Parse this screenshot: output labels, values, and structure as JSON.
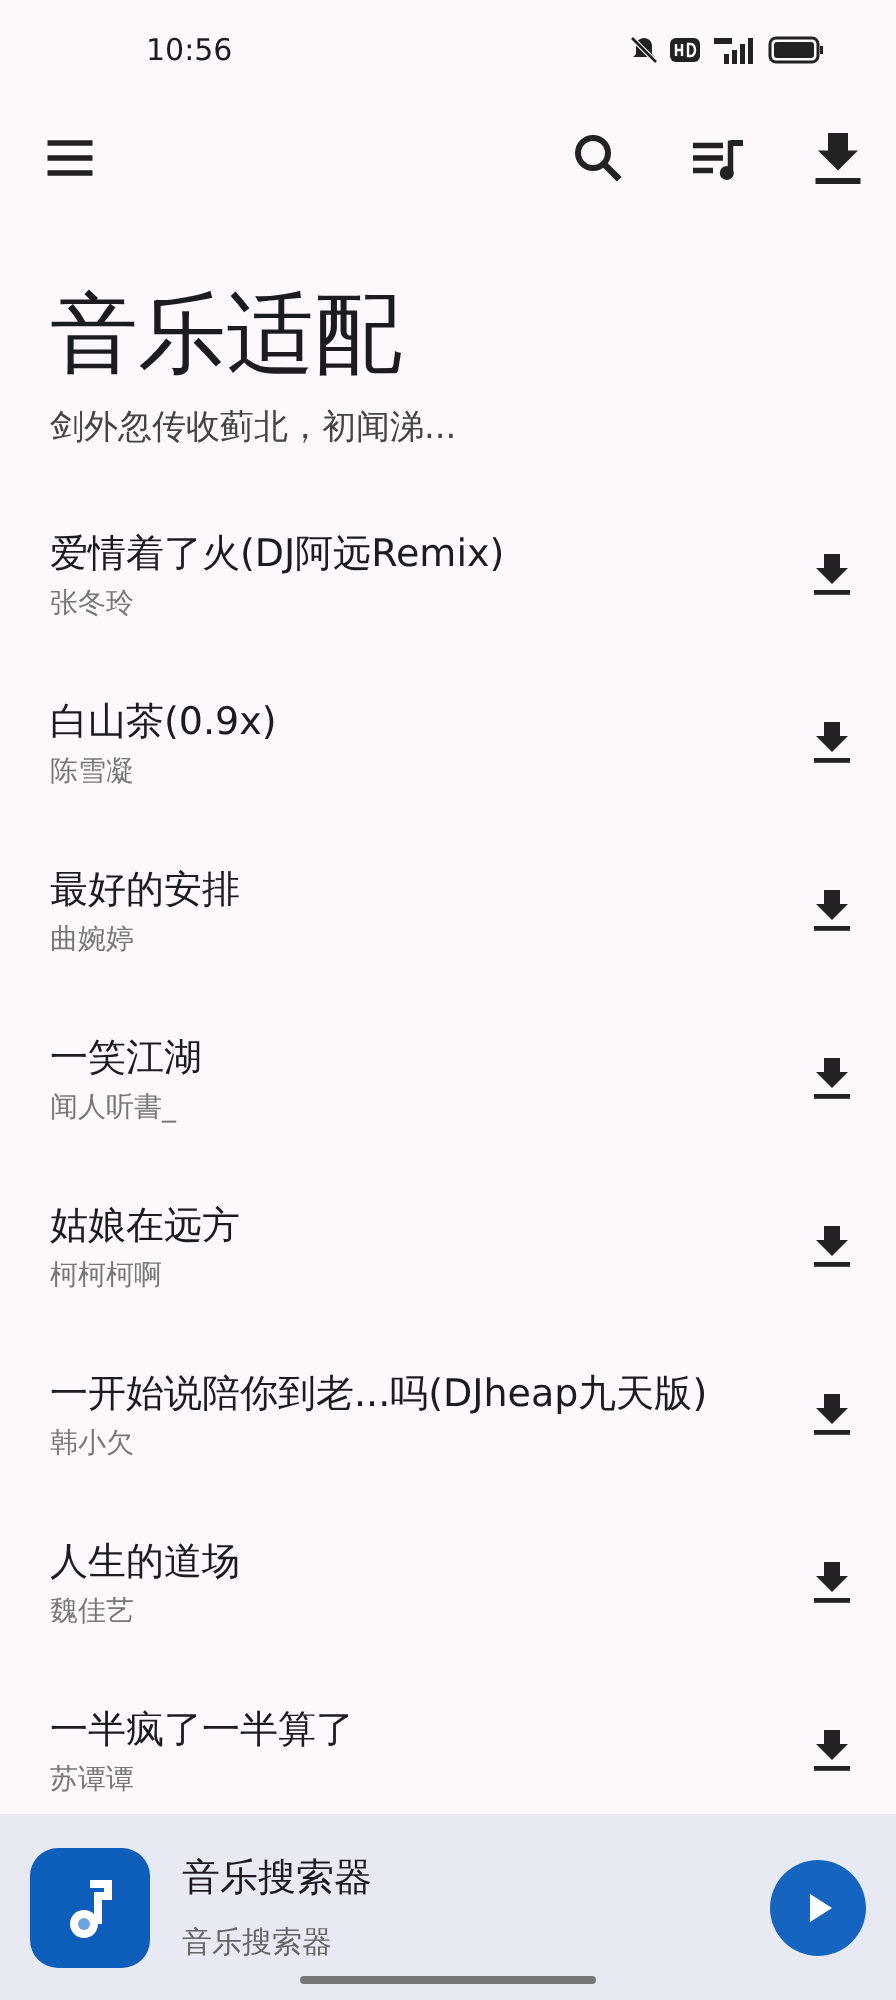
{
  "status_bar": {
    "time": "10:56"
  },
  "header": {
    "title": "音乐适配",
    "subtitle": "剑外忽传收蓟北，初闻涕..."
  },
  "songs": [
    {
      "title": "爱情着了火(DJ阿远Remix)",
      "artist": "张冬玲"
    },
    {
      "title": "白山茶(0.9x)",
      "artist": "陈雪凝"
    },
    {
      "title": "最好的安排",
      "artist": "曲婉婷"
    },
    {
      "title": "一笑江湖",
      "artist": "闻人听書_"
    },
    {
      "title": "姑娘在远方",
      "artist": "柯柯柯啊"
    },
    {
      "title": "一开始说陪你到老...吗(DJheap九天版)",
      "artist": "韩小欠"
    },
    {
      "title": "人生的道场",
      "artist": "魏佳艺"
    },
    {
      "title": "一半疯了一半算了",
      "artist": "苏谭谭"
    }
  ],
  "player": {
    "title": "音乐搜索器",
    "subtitle": "音乐搜索器"
  }
}
